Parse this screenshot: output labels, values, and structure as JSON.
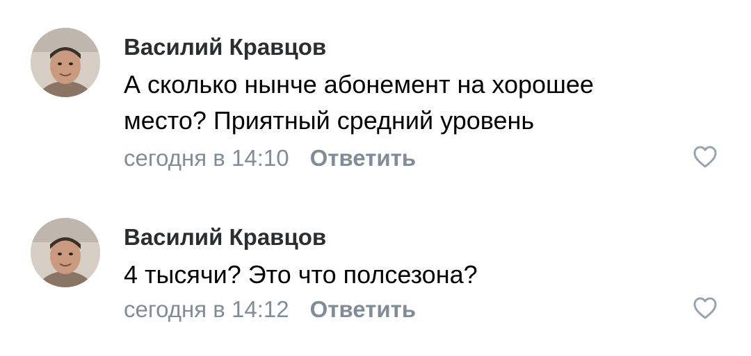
{
  "comments": [
    {
      "author": "Василий Кравцов",
      "text": "А сколько нынче абонемент на хорошее место? Приятный средний уровень",
      "time": "сегодня в 14:10",
      "reply_label": "Ответить",
      "like_icon": "heart-outline-icon"
    },
    {
      "author": "Василий Кравцов",
      "text": "4 тысячи? Это что полсезона?",
      "time": "сегодня в 14:12",
      "reply_label": "Ответить",
      "like_icon": "heart-outline-icon"
    }
  ],
  "colors": {
    "author": "#2c2d2e",
    "text": "#000000",
    "meta": "#818c99",
    "like_icon": "#99a2ad"
  }
}
